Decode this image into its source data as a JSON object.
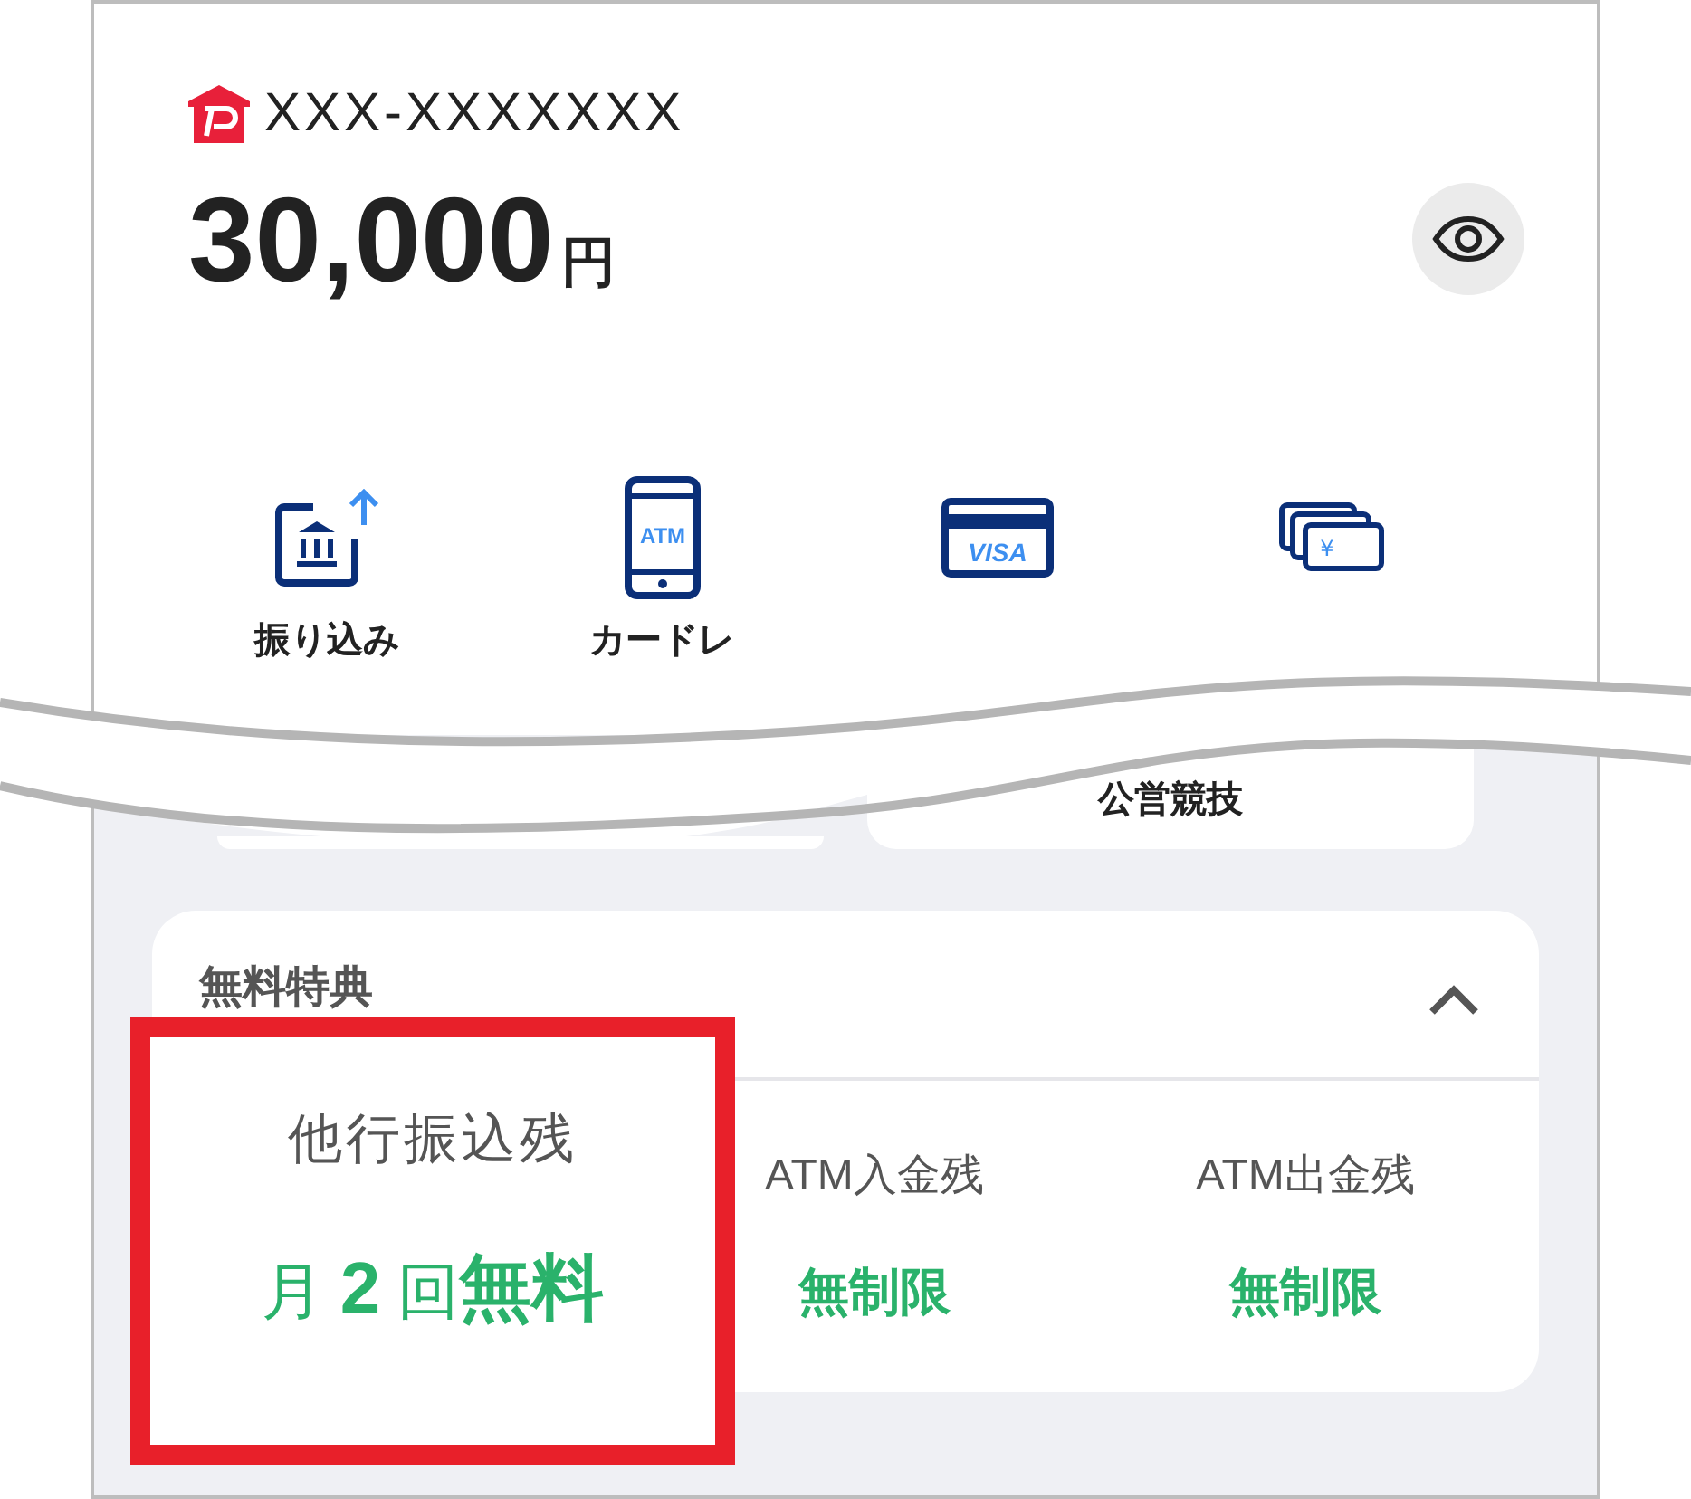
{
  "account": {
    "number": "XXX-XXXXXXX"
  },
  "balance": {
    "amount": "30,000",
    "unit": "円"
  },
  "actions": [
    {
      "kind": "transfer",
      "label": "振り込み"
    },
    {
      "kind": "atm",
      "label": "カードレ",
      "icon_text": "ATM"
    },
    {
      "kind": "card",
      "icon_text": "VISA"
    },
    {
      "kind": "cash",
      "icon_text": "¥"
    }
  ],
  "cards": [
    {
      "kind": "plain"
    },
    {
      "kind": "labeled",
      "label": "公営競技"
    }
  ],
  "benefits": {
    "title": "無料特典",
    "expanded": true,
    "items": [
      {
        "label": "ATM入金残",
        "value": "無制限"
      },
      {
        "label": "ATM出金残",
        "value": "無制限"
      }
    ]
  },
  "callout": {
    "label": "他行振込残",
    "value": "月 **2** 回**無料**"
  }
}
